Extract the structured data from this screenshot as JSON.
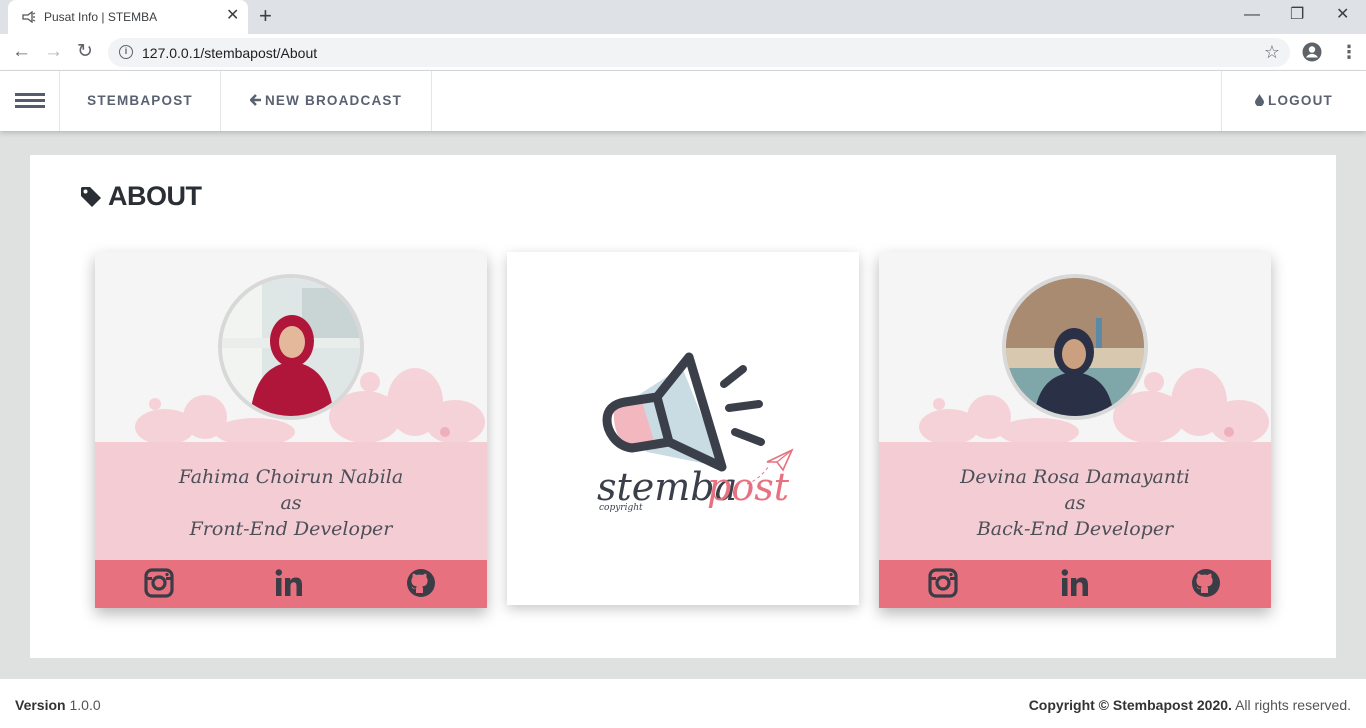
{
  "browser": {
    "tab_title": "Pusat Info | STEMBA",
    "tab_close": "✕",
    "new_tab": "+",
    "url": "127.0.0.1/stembapost/About",
    "window_controls": {
      "minimize": "—",
      "restore": "❐",
      "close": "✕"
    },
    "nav_icons": {
      "back": "←",
      "forward": "→",
      "reload": "↻"
    }
  },
  "header": {
    "brand": "STEMBAPOST",
    "new_broadcast": "NEW BROADCAST",
    "logout": "LOGOUT"
  },
  "page": {
    "title": "ABOUT"
  },
  "team": [
    {
      "name": "Fahima Choirun Nabila",
      "as": "as",
      "role": "Front-End Developer",
      "hijab_color": "#b0163a"
    },
    {
      "name": "Devina Rosa Damayanti",
      "as": "as",
      "role": "Back-End Developer",
      "hijab_color": "#2a3045"
    }
  ],
  "logo": {
    "word1": "stemba",
    "word2": "post",
    "small": "copyright"
  },
  "footer": {
    "version_label": "Version",
    "version_value": "1.0.0",
    "copyright_bold": "Copyright © Stembapost 2020.",
    "copyright_rest": "All rights reserved."
  },
  "colors": {
    "accent_pink": "#e87180",
    "light_pink": "#f4ccd3",
    "text_dark": "#2a2e35"
  }
}
